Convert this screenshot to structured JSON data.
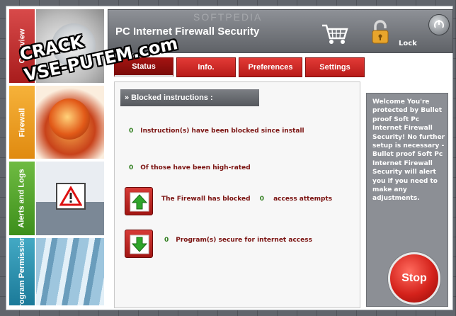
{
  "app": {
    "title": "PC Internet Firewall Security",
    "watermark": "SOFTPEDIA",
    "lock_label": "Lock"
  },
  "sidebar": {
    "items": [
      {
        "label": "Overview"
      },
      {
        "label": "Firewall"
      },
      {
        "label": "Alerts and Logs"
      },
      {
        "label": "Program Permissions"
      }
    ]
  },
  "tabs": [
    {
      "label": "Status",
      "active": true
    },
    {
      "label": "Info."
    },
    {
      "label": "Preferences"
    },
    {
      "label": "Settings"
    }
  ],
  "status": {
    "section_title": "» Blocked instructions :",
    "lines": [
      {
        "value": "0",
        "text": "Instruction(s) have been blocked  since install"
      },
      {
        "value": "0",
        "text": "Of those have been high-rated"
      }
    ],
    "blocked": {
      "prefix": "The Firewall has blocked",
      "value": "0",
      "suffix": "access attempts"
    },
    "secure": {
      "value": "0",
      "text": "Program(s) secure for internet  access"
    }
  },
  "info_panel": {
    "text": "Welcome You're protected by Bullet proof Soft Pc Internet Firewall Security!  No further setup is necessary - Bullet proof Soft  Pc Internet Firewall Security will alert you if you need to make any adjustments.",
    "stop_label": "Stop"
  },
  "overlay": {
    "line1": "CRACK",
    "line2": "VSE-PUTEM.com"
  }
}
